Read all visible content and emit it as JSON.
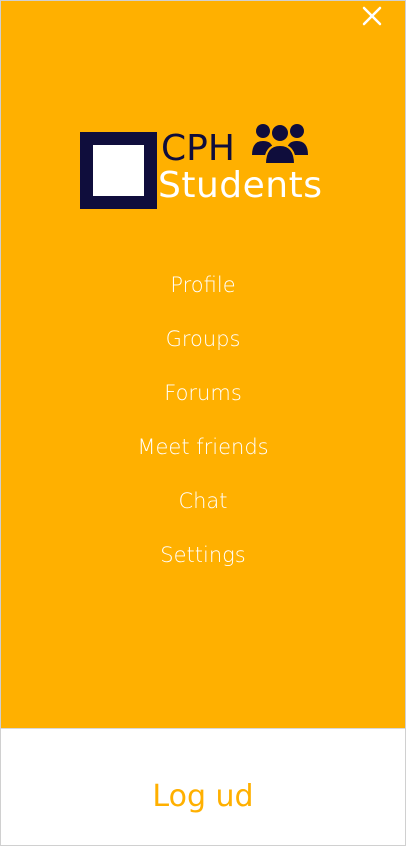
{
  "colors": {
    "accent": "#FFB000",
    "logo_dark": "#0f0d3c",
    "text_light": "#ffffff"
  },
  "header": {
    "close_icon": "close-icon"
  },
  "logo": {
    "line1": "CPH",
    "line2": "Students",
    "icon": "group-icon"
  },
  "nav": {
    "items": [
      {
        "label": "Profile"
      },
      {
        "label": "Groups"
      },
      {
        "label": "Forums"
      },
      {
        "label": "Meet friends"
      },
      {
        "label": "Chat"
      },
      {
        "label": "Settings"
      }
    ]
  },
  "footer": {
    "logout_label": "Log ud"
  }
}
